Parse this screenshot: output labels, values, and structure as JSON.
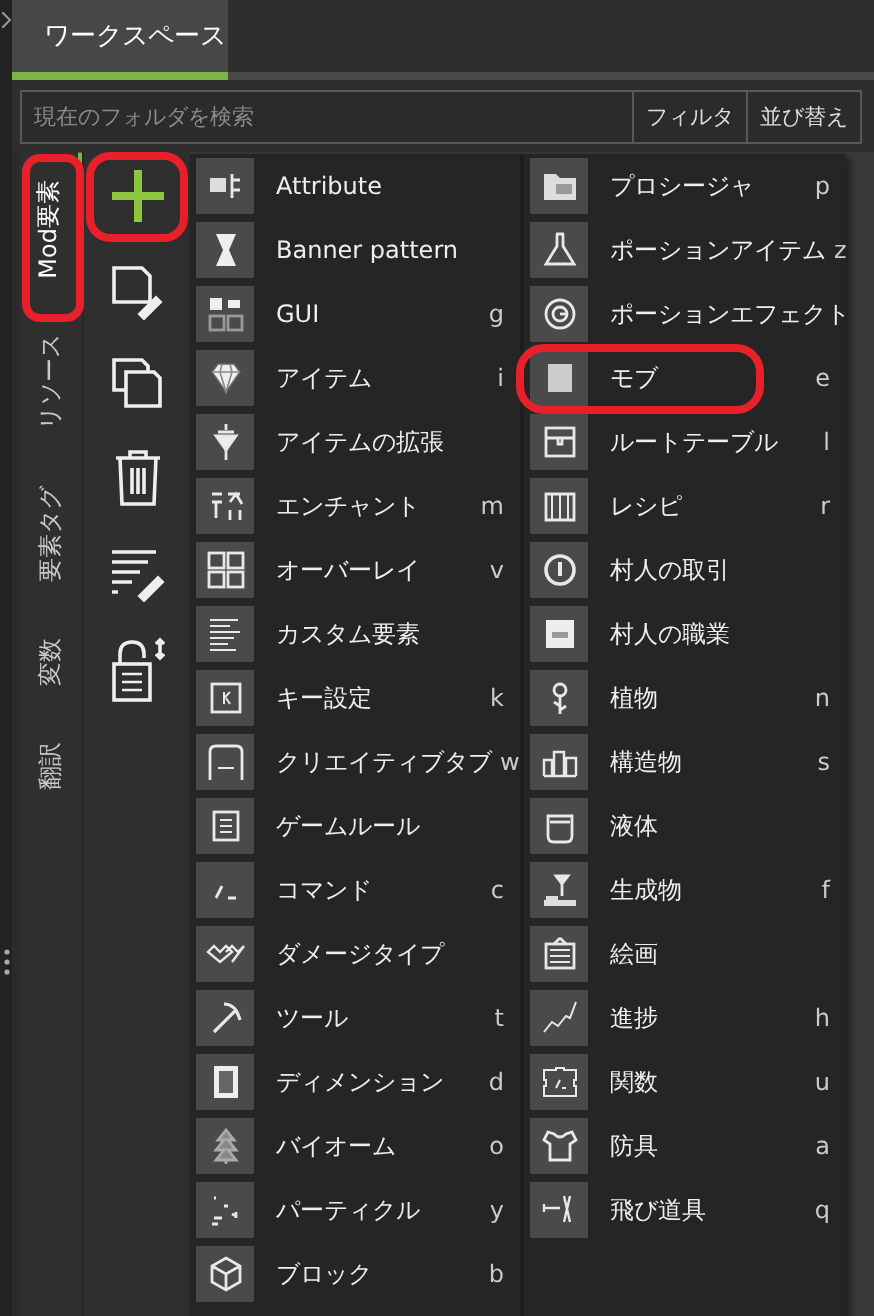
{
  "tabs": [
    {
      "label": "ワークスペース",
      "selected": true
    }
  ],
  "search": {
    "placeholder": "現在のフォルダを検索"
  },
  "search_buttons": [
    "フィルタ",
    "並び替え"
  ],
  "side_tabs": [
    {
      "label": "Mod要素",
      "selected": true,
      "highlighted": true
    },
    {
      "label": "リソース",
      "selected": false,
      "highlighted": false
    },
    {
      "label": "要素タグ",
      "selected": false,
      "highlighted": false
    },
    {
      "label": "変数",
      "selected": false,
      "highlighted": false
    },
    {
      "label": "翻訳",
      "selected": false,
      "highlighted": false
    }
  ],
  "toolbar": [
    {
      "kind": "add",
      "highlighted": true
    },
    {
      "kind": "edit",
      "highlighted": false
    },
    {
      "kind": "duplicate",
      "highlighted": false
    },
    {
      "kind": "delete",
      "highlighted": false
    },
    {
      "kind": "list_edit",
      "highlighted": false
    },
    {
      "kind": "lock",
      "highlighted": false
    }
  ],
  "menu": {
    "columns": [
      [
        {
          "label": "Attribute",
          "highlighted": false
        },
        {
          "label": "Banner pattern",
          "highlighted": false
        },
        {
          "label": "GUI",
          "key": "g",
          "highlighted": false
        },
        {
          "label": "アイテム",
          "key": "i",
          "highlighted": false
        },
        {
          "label": "アイテムの拡張",
          "highlighted": false
        },
        {
          "label": "エンチャント",
          "key": "m",
          "highlighted": false
        },
        {
          "label": "オーバーレイ",
          "key": "v",
          "highlighted": false
        },
        {
          "label": "カスタム要素",
          "highlighted": false
        },
        {
          "label": "キー設定",
          "key": "k",
          "highlighted": false
        },
        {
          "label": "クリエイティブタブ",
          "key": "w",
          "highlighted": false
        },
        {
          "label": "ゲームルール",
          "highlighted": false
        },
        {
          "label": "コマンド",
          "key": "c",
          "highlighted": false
        },
        {
          "label": "ダメージタイプ",
          "highlighted": false
        },
        {
          "label": "ツール",
          "key": "t",
          "highlighted": false
        },
        {
          "label": "ディメンション",
          "key": "d",
          "highlighted": false
        },
        {
          "label": "バイオーム",
          "key": "o",
          "highlighted": false
        },
        {
          "label": "パーティクル",
          "key": "y",
          "highlighted": false
        },
        {
          "label": "ブロック",
          "key": "b",
          "highlighted": false
        }
      ],
      [
        {
          "label": "プロシージャ",
          "key": "p",
          "highlighted": false
        },
        {
          "label": "ポーションアイテム",
          "key": "z",
          "highlighted": false
        },
        {
          "label": "ポーションエフェクト",
          "highlighted": false
        },
        {
          "label": "モブ",
          "key": "e",
          "highlighted": true
        },
        {
          "label": "ルートテーブル",
          "key": "l",
          "highlighted": false
        },
        {
          "label": "レシピ",
          "key": "r",
          "highlighted": false
        },
        {
          "label": "村人の取引",
          "highlighted": false
        },
        {
          "label": "村人の職業",
          "highlighted": false
        },
        {
          "label": "植物",
          "key": "n",
          "highlighted": false
        },
        {
          "label": "構造物",
          "key": "s",
          "highlighted": false
        },
        {
          "label": "液体",
          "highlighted": false
        },
        {
          "label": "生成物",
          "key": "f",
          "highlighted": false
        },
        {
          "label": "絵画",
          "highlighted": false
        },
        {
          "label": "進捗",
          "key": "h",
          "highlighted": false
        },
        {
          "label": "関数",
          "key": "u",
          "highlighted": false
        },
        {
          "label": "防具",
          "key": "a",
          "highlighted": false
        },
        {
          "label": "飛び道具",
          "key": "q",
          "highlighted": false
        }
      ]
    ]
  }
}
